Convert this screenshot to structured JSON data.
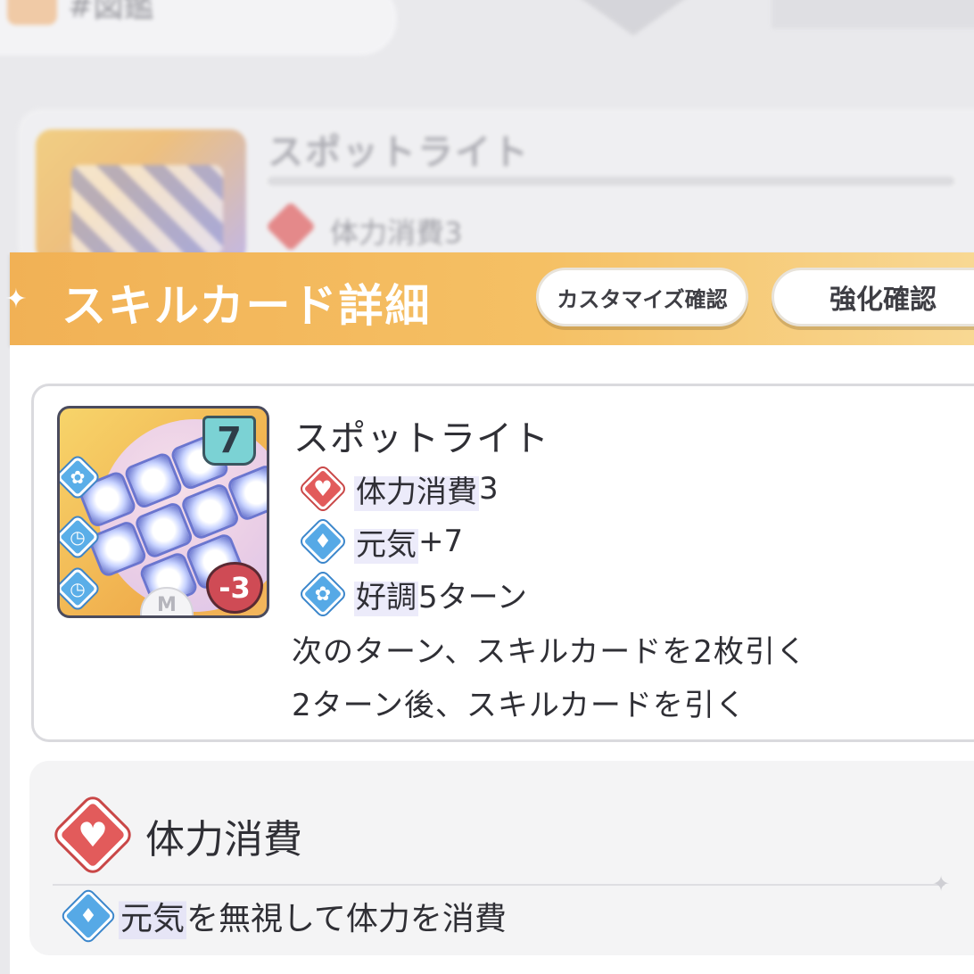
{
  "background": {
    "topbar_label": "#図鑑",
    "card_title": "スポットライト",
    "card_effect": "体力消費3"
  },
  "header": {
    "title": "スキルカード詳細",
    "customize_button": "カスタマイズ確認",
    "enhance_button": "強化確認"
  },
  "card": {
    "cost": "7",
    "hp_badge": "-3",
    "rarity": "M",
    "name": "スポットライト",
    "effects": [
      {
        "icon": "heart-icon",
        "keyword": "体力消費",
        "value": "3"
      },
      {
        "icon": "genki-icon",
        "keyword": "元気",
        "value": "+7"
      },
      {
        "icon": "koucho-icon",
        "keyword": "好調",
        "value": "5ターン"
      }
    ],
    "description": [
      "次のターン、スキルカードを2枚引く",
      "2ターン後、スキルカードを引く"
    ]
  },
  "keyword_panel": {
    "title": "体力消費",
    "icon": "heart-icon",
    "detail_keyword": "元気",
    "detail_text": "を無視して体力を消費"
  },
  "colors": {
    "header_orange": "#f1b155",
    "hp_red": "#e25b5b",
    "buff_blue": "#56a9e6"
  }
}
